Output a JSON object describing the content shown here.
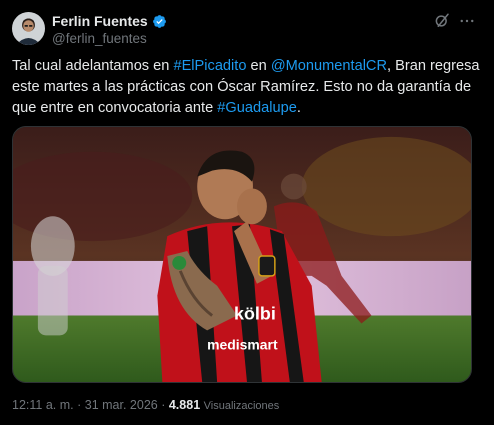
{
  "author": {
    "display_name": "Ferlin Fuentes",
    "handle": "@ferlin_fuentes"
  },
  "tweet": {
    "segments": [
      {
        "text": "Tal cual adelantamos en ",
        "link": false
      },
      {
        "text": "#ElPicadito",
        "link": true
      },
      {
        "text": " en ",
        "link": false
      },
      {
        "text": "@MonumentalCR",
        "link": true
      },
      {
        "text": ", Bran regresa este martes a las prácticas con Óscar Ramírez. Esto no da garantía de que entre en convocatoria ante ",
        "link": false
      },
      {
        "text": "#Guadalupe",
        "link": true
      },
      {
        "text": ".",
        "link": false
      }
    ]
  },
  "media": {
    "jersey_sponsor": "kölbi",
    "jersey_sponsor_2": "medismart"
  },
  "meta": {
    "time": "12:11 a. m.",
    "separator": "·",
    "date": "31 mar. 2026",
    "views_count": "4.881",
    "views_label": "Visualizaciones"
  },
  "colors": {
    "background": "#000000",
    "text": "#e7e9ea",
    "secondary": "#71767b",
    "link": "#1d9bf0",
    "verified": "#1d9bf0"
  },
  "icons": {
    "verified": "verified-badge-icon",
    "grok": "grok-icon",
    "more": "more-dots-icon"
  }
}
